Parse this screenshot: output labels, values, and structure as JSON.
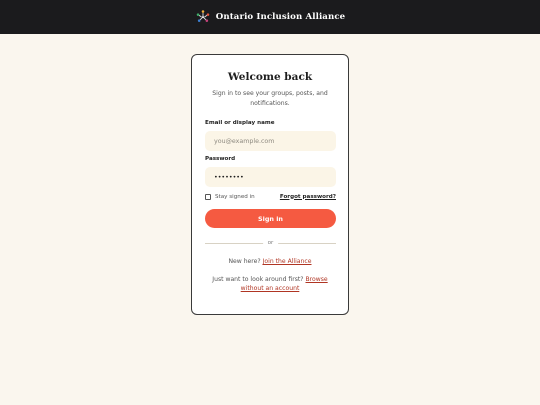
{
  "header": {
    "brand_name": "Ontario Inclusion Alliance",
    "logo_icon": "multicolor-figures-circle-icon"
  },
  "signin": {
    "title": "Welcome back",
    "subtitle": "Sign in to see your groups, posts, and notifications.",
    "email_label": "Email or display name",
    "email_placeholder": "you@example.com",
    "password_label": "Password",
    "password_value": "••••••••",
    "remember_label": "Stay signed in",
    "remember_checked": false,
    "forgot_label": "Forgot password?",
    "submit_label": "Sign in",
    "divider_label": "or",
    "new_here_text": "New here?",
    "join_link": "Join the Alliance",
    "browse_text": "Just want to look around first?",
    "browse_link": "Browse without an account"
  },
  "colors": {
    "topbar": "#1b1b1d",
    "background": "#faf6ee",
    "accent": "#f55a41",
    "link": "#b03523",
    "input_bg": "#fbf5e7"
  }
}
